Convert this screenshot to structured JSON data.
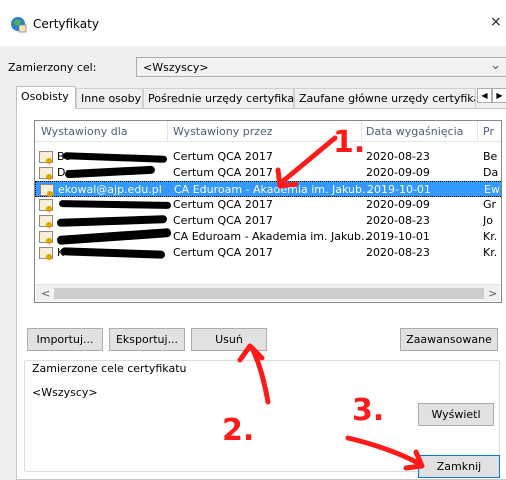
{
  "window": {
    "title": "Certyfikaty",
    "close_glyph": "×",
    "icon": "certificate-app-icon"
  },
  "purpose": {
    "label": "Zamierzony cel:",
    "value": "<Wszyscy>",
    "chevron": "⌄"
  },
  "tabs": [
    {
      "label": "Osobisty",
      "selected": true
    },
    {
      "label": "Inne osoby"
    },
    {
      "label": "Pośrednie urzędy certyfikacji"
    },
    {
      "label": "Zaufane główne urzędy certyfikacji"
    }
  ],
  "tab_scroll": {
    "left": "◀",
    "right": "▶"
  },
  "table": {
    "columns": [
      "Wystawiony dla",
      "Wystawiony przez",
      "Data wygaśnięcia",
      "Pr"
    ],
    "rows": [
      {
        "issued_to": "Bo",
        "issued_by": "Certum QCA 2017",
        "expires": "2020-08-23",
        "name": "Be"
      },
      {
        "issued_to": "Dr",
        "issued_by": "Certum QCA 2017",
        "expires": "2020-09-09",
        "name": "Da"
      },
      {
        "issued_to": "ekowal@ajp.edu.pl",
        "issued_by": "CA Eduroam - Akademia im. Jakub…",
        "expires": "2019-10-01",
        "name": "Ew",
        "selected": true
      },
      {
        "issued_to": "",
        "issued_by": "Certum QCA 2017",
        "expires": "2020-09-09",
        "name": "Gr"
      },
      {
        "issued_to": "",
        "issued_by": "Certum QCA 2017",
        "expires": "2020-08-23",
        "name": "Jo"
      },
      {
        "issued_to": "",
        "issued_by": "CA Eduroam - Akademia im. Jakub…",
        "expires": "2019-10-01",
        "name": "Kr."
      },
      {
        "issued_to": "K",
        "issued_by": "Certum QCA 2017",
        "expires": "2020-08-23",
        "name": "Kr."
      }
    ],
    "scroll_left": "<",
    "scroll_right": ">"
  },
  "buttons": {
    "import": "Importuj...",
    "export": "Eksportuj...",
    "remove": "Usuń",
    "advanced": "Zaawansowane",
    "view": "Wyświetl",
    "close": "Zamknij"
  },
  "purposes_group": {
    "title": "Zamierzone cele certyfikatu",
    "value": "<Wszyscy>"
  },
  "annotations": {
    "one": "1.",
    "two": "2.",
    "three": "3.",
    "color": "#ff1a1a"
  }
}
